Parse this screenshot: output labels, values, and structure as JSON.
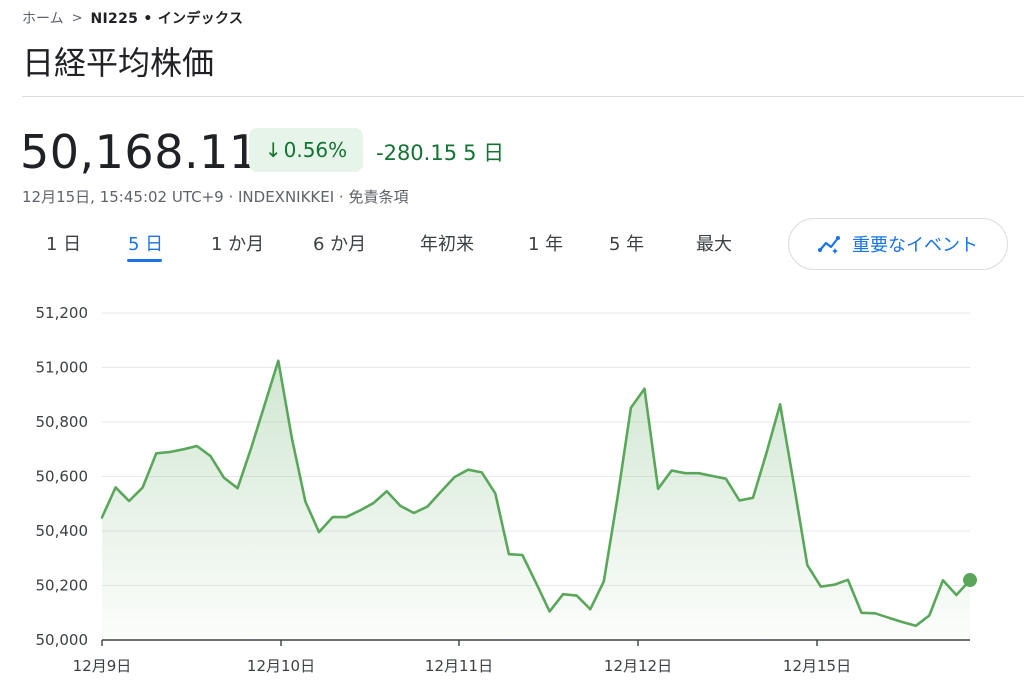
{
  "breadcrumb": {
    "home": "ホーム",
    "separator": ">",
    "current": "NI225 • インデックス"
  },
  "page_title": "日経平均株価",
  "quote": {
    "price": "50,168.11",
    "change_percent": "0.56%",
    "change_value": "-280.15",
    "change_period": "5 日",
    "direction_icon": "arrow-down-icon",
    "timestamp_line": "12月15日, 15:45:02 UTC+9 · INDEXNIKKEI · 免責条項"
  },
  "range_tabs": [
    {
      "label": "1 日",
      "active": false
    },
    {
      "label": "5 日",
      "active": true
    },
    {
      "label": "1 か月",
      "active": false
    },
    {
      "label": "6 か月",
      "active": false
    },
    {
      "label": "年初来",
      "active": false
    },
    {
      "label": "1 年",
      "active": false
    },
    {
      "label": "5 年",
      "active": false
    },
    {
      "label": "最大",
      "active": false
    }
  ],
  "events_button": {
    "label": "重要なイベント",
    "icon": "sparkline-icon"
  },
  "colors": {
    "up_down_green": "#137333",
    "badge_bg": "#e6f4ea",
    "line": "#5aa75b",
    "accent_blue": "#1a73e8"
  },
  "chart_data": {
    "type": "area",
    "title": "",
    "xlabel": "",
    "ylabel": "",
    "ylim": [
      50000,
      51200
    ],
    "yticks": [
      51200,
      51000,
      50800,
      50600,
      50400,
      50200,
      50000
    ],
    "ytick_labels": [
      "51,200",
      "51,000",
      "50,800",
      "50,600",
      "50,400",
      "50,200",
      "50,000"
    ],
    "xtick_labels": [
      "12月9日",
      "12月10日",
      "12月11日",
      "12月12日",
      "12月15日"
    ],
    "grid": true,
    "series": [
      {
        "values": [
          50450,
          50560,
          50510,
          50560,
          50685,
          50690,
          50700,
          50712,
          50675,
          50595,
          50557,
          50705,
          50865,
          51025,
          50740,
          50508,
          50396,
          50451,
          50451,
          50475,
          50502,
          50546,
          50492,
          50466,
          50490,
          50545,
          50598,
          50625,
          50615,
          50538,
          50315,
          50312,
          50210,
          50105,
          50168,
          50163,
          50113,
          50215,
          50520,
          50852,
          50922,
          50555,
          50622,
          50612,
          50612,
          50602,
          50592,
          50512,
          50522,
          50688,
          50865,
          50575,
          50275,
          50196,
          50203,
          50221,
          50100,
          50098,
          50082,
          50066,
          50052,
          50090,
          50219,
          50165,
          50220
        ]
      }
    ],
    "last_point": 50220
  }
}
